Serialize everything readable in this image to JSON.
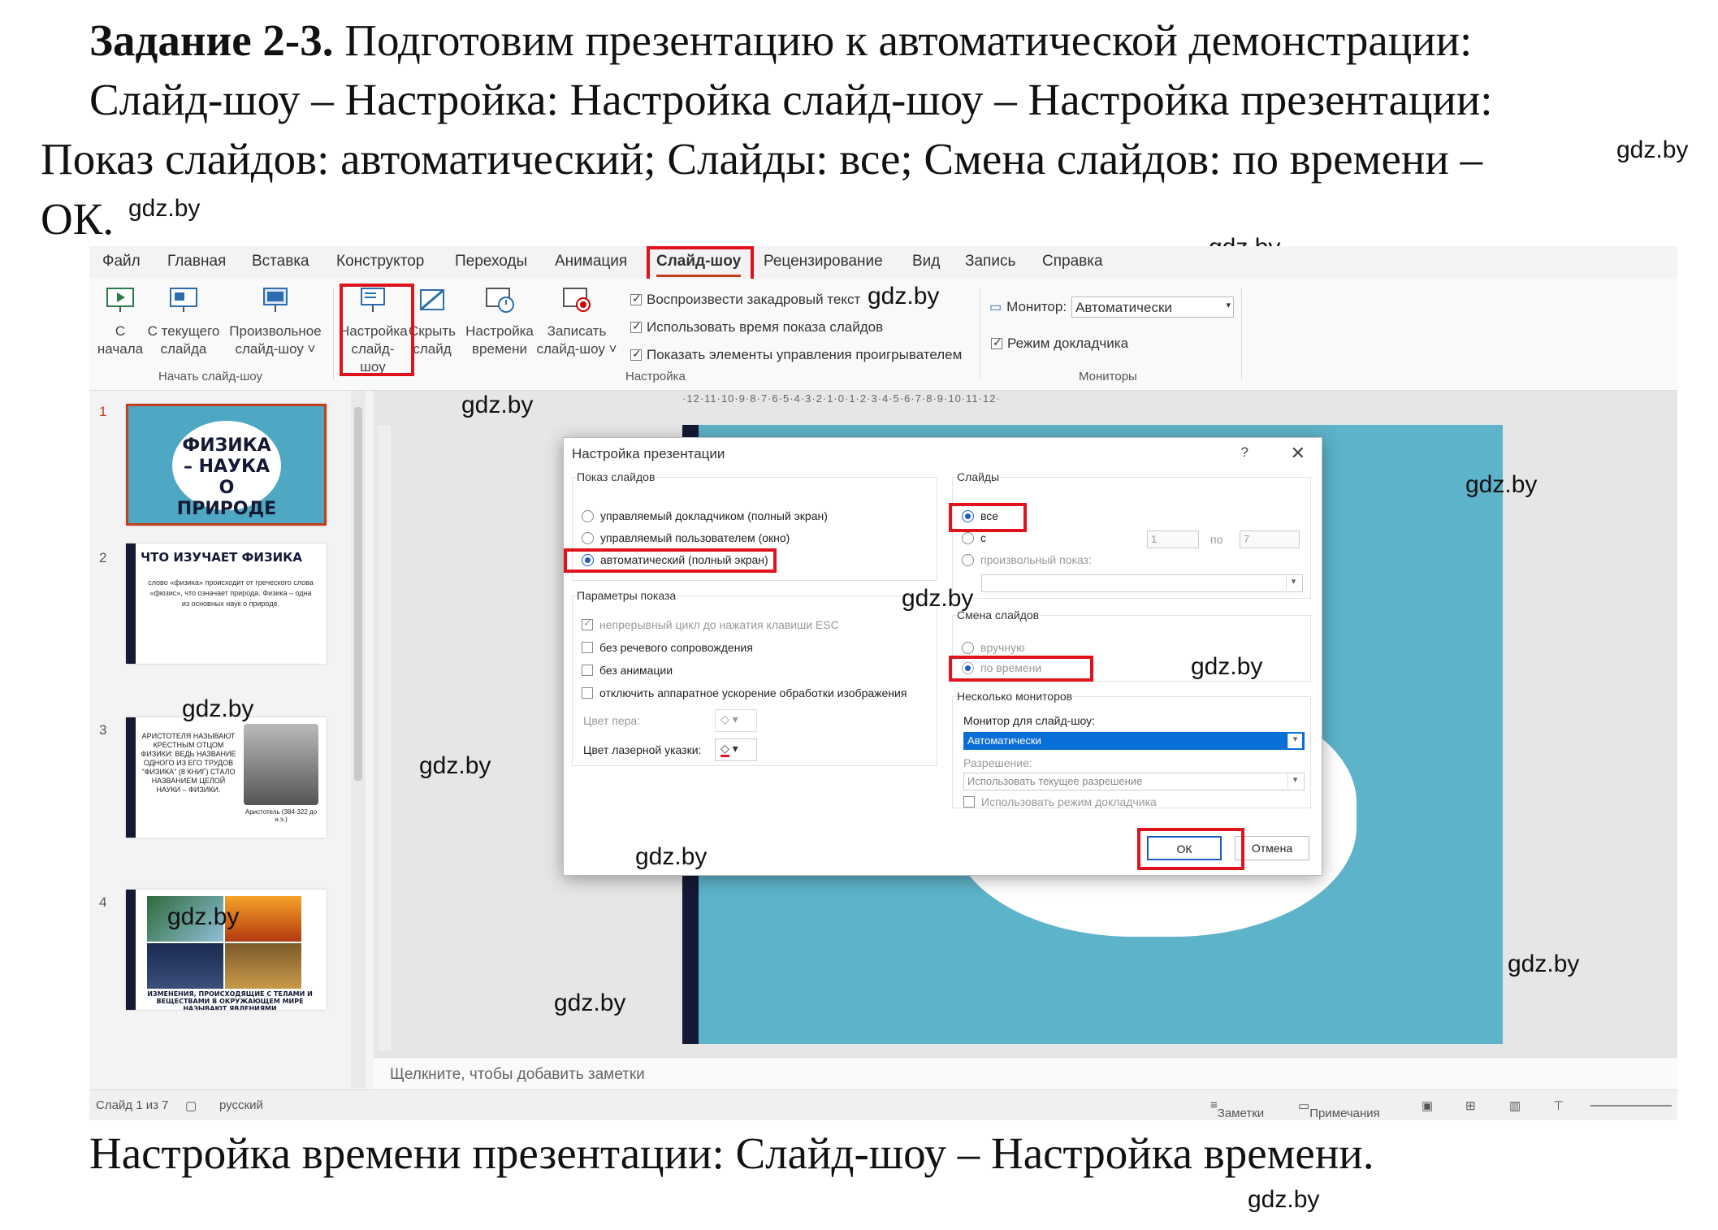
{
  "task": {
    "bold": "Задание 2-3.",
    "line1_rest": " Подготовим презентацию к автоматической демонстрации:",
    "line2": "Слайд-шоу – Настройка: Настройка слайд-шоу – Настройка презентации:",
    "line3": "Показ слайдов: автоматический; Слайды: все; Смена слайдов: по времени –",
    "line4": "ОК."
  },
  "caption": "Настройка времени презентации: Слайд-шоу – Настройка времени.",
  "watermark": "gdz.by",
  "menu": {
    "tabs": [
      "Файл",
      "Главная",
      "Вставка",
      "Конструктор",
      "Переходы",
      "Анимация",
      "Слайд-шоу",
      "Рецензирование",
      "Вид",
      "Запись",
      "Справка"
    ]
  },
  "ribbon": {
    "from_start": "С\nначала",
    "from_current": "С текущего\nслайда",
    "custom": "Произвольное\nслайд-шоу ˅",
    "group_start": "Начать слайд-шоу",
    "setup": "Настройка\nслайд-шоу",
    "hide": "Скрыть\nслайд",
    "timing": "Настройка\nвремени",
    "record": "Записать\nслайд-шоу ˅",
    "check_narration": "Воспроизвести закадровый текст",
    "check_timings": "Использовать время показа слайдов",
    "check_media": "Показать элементы управления проигрывателем",
    "group_setup": "Настройка",
    "monitor_label": "Монитор:",
    "monitor_value": "Автоматически",
    "presenter_view": "Режим докладчика",
    "group_monitors": "Мониторы"
  },
  "thumbnails": {
    "n1": "1",
    "n2": "2",
    "n3": "3",
    "n4": "4",
    "s1_title": "ФИЗИКА – НАУКА О ПРИРОДЕ",
    "s2_title": "ЧТО ИЗУЧАЕТ ФИЗИКА",
    "s2_text": "слово «физика» происходит от греческого слова «фюзис», что означает природа. Физика – одна из основных наук о природе.",
    "s3_text": "АРИСТОТЕЛЯ НАЗЫВАЮТ КРЕСТНЫМ ОТЦОМ ФИЗИКИ: ВЕДЬ НАЗВАНИЕ ОДНОГО ИЗ ЕГО ТРУДОВ \"ФИЗИКА\" (8 КНИГ) СТАЛО НАЗВАНИЕМ ЦЕЛОЙ НАУКИ – ФИЗИКИ.",
    "s3_caption": "Аристотель (384-322 до н.э.)",
    "s4_text": "ИЗМЕНЕНИЯ, ПРОИСХОДЯЩИЕ С ТЕЛАМИ И ВЕЩЕСТВАМИ В ОКРУЖАЮЩЕМ МИРЕ НАЗЫВАЮТ ЯВЛЕНИЯМИ"
  },
  "ruler": "·12·11·10·9·8·7·6·5·4·3·2·1·0·1·2·3·4·5·6·7·8·9·10·11·12·",
  "notes_placeholder": "Щелкните, чтобы добавить заметки",
  "status": {
    "slide": "Слайд 1 из 7",
    "lang": "русский",
    "notes": "Заметки",
    "comments": "Примечания"
  },
  "dialog": {
    "title": "Настройка презентации",
    "help": "?",
    "close": "✕",
    "show_type_legend": "Показ слайдов",
    "opt_presenter": "управляемый докладчиком (полный экран)",
    "opt_individual": "управляемый пользователем (окно)",
    "opt_kiosk": "автоматический (полный экран)",
    "show_options_legend": "Параметры показа",
    "loop": "непрерывный цикл до нажатия клавиши ESC",
    "no_narration": "без речевого сопровождения",
    "no_animation": "без анимации",
    "no_hw_accel": "отключить аппаратное ускорение обработки изображения",
    "pen_color": "Цвет пера:",
    "laser_color": "Цвет лазерной указки:",
    "slides_legend": "Слайды",
    "all": "все",
    "from": "с",
    "from_value": "1",
    "to": "по",
    "to_value": "7",
    "custom_show": "произвольный показ:",
    "advance_legend": "Смена слайдов",
    "manually": "вручную",
    "timings": "по времени",
    "multi_legend": "Несколько мониторов",
    "monitor_for": "Монитор для слайд-шоу:",
    "monitor_value": "Автоматически",
    "resolution": "Разрешение:",
    "resolution_value": "Использовать текущее разрешение",
    "use_presenter": "Использовать режим докладчика",
    "ok": "ОК",
    "cancel": "Отмена"
  },
  "colors": {
    "highlight": "#e0121c",
    "accent": "#c43e1c",
    "slide_bg": "#5db3c9"
  }
}
